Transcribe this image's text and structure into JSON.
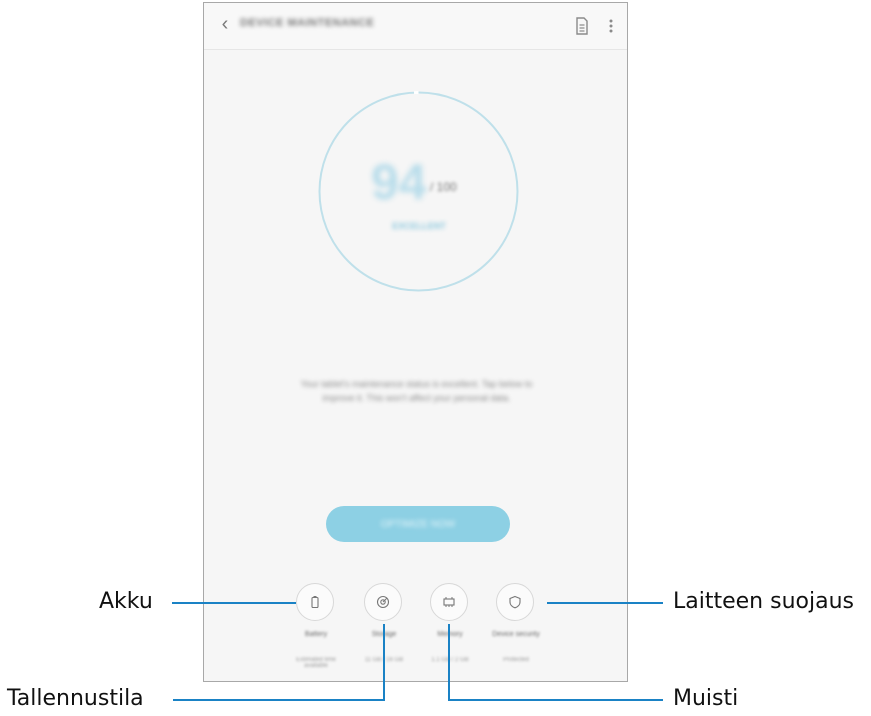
{
  "app": {
    "title": "DEVICE MAINTENANCE",
    "back_icon": "back-arrow-icon",
    "report_icon": "document-icon",
    "more_icon": "more-vertical-icon"
  },
  "score": {
    "value": "94",
    "max": "/ 100",
    "status": "EXCELLENT",
    "accent": "#8dd0e4"
  },
  "message": "Your tablet's maintenance status is excellent. Tap below to improve it. This won't affect your personal data.",
  "optimize_button": {
    "label": "OPTIMIZE NOW"
  },
  "categories": [
    {
      "icon": "battery-icon",
      "label": "Battery",
      "value": "Estimated time available"
    },
    {
      "icon": "storage-icon",
      "label": "Storage",
      "value": "11 GB / 16 GB"
    },
    {
      "icon": "memory-icon",
      "label": "Memory",
      "value": "1.1 GB / 2 GB"
    },
    {
      "icon": "security-icon",
      "label": "Device security",
      "value": "Protected"
    }
  ],
  "callouts": {
    "akku": "Akku",
    "tallennustila": "Tallennustila",
    "muisti": "Muisti",
    "laitteen_suojaus": "Laitteen suojaus"
  }
}
